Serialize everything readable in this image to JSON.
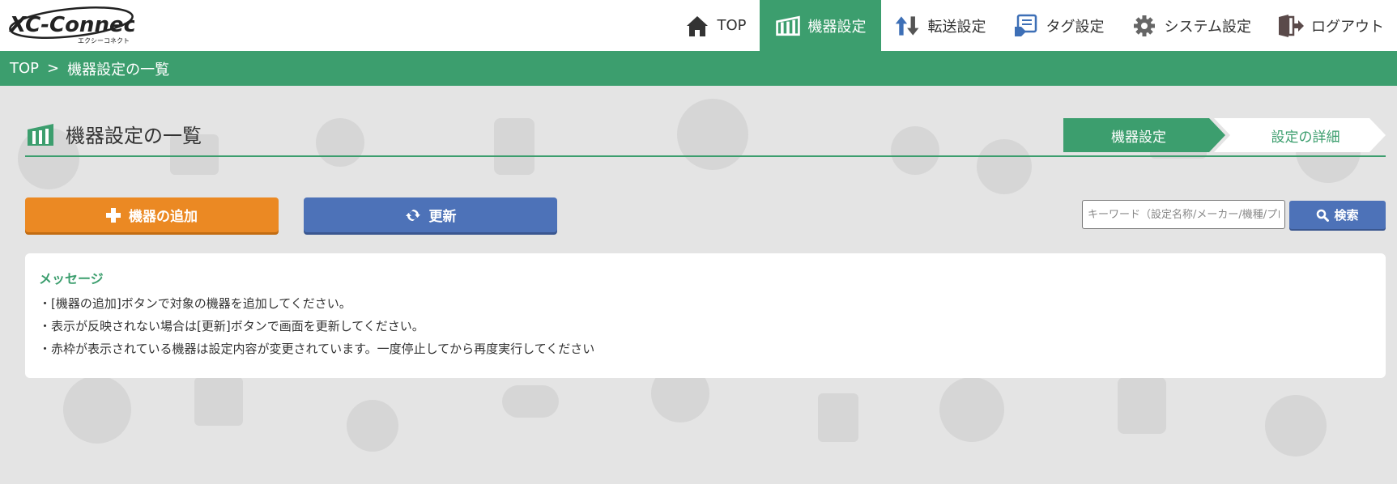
{
  "logo": {
    "text": "XC-Connect",
    "sub": "エクシーコネクト"
  },
  "nav": {
    "items": [
      {
        "label": "TOP",
        "icon": "home-icon"
      },
      {
        "label": "機器設定",
        "icon": "devices-icon",
        "active": true
      },
      {
        "label": "転送設定",
        "icon": "transfer-arrows-icon"
      },
      {
        "label": "タグ設定",
        "icon": "tag-icon"
      },
      {
        "label": "システム設定",
        "icon": "gear-icon"
      },
      {
        "label": "ログアウト",
        "icon": "logout-icon"
      }
    ]
  },
  "breadcrumb": {
    "root": "TOP",
    "separator": ">",
    "current": "機器設定の一覧"
  },
  "page": {
    "title": "機器設定の一覧"
  },
  "steps": [
    {
      "label": "機器設定",
      "active": true
    },
    {
      "label": "設定の詳細",
      "active": false
    }
  ],
  "toolbar": {
    "add_label": "機器の追加",
    "refresh_label": "更新",
    "search_placeholder": "キーワード（設定名称/メーカー/機種/プロトコル）",
    "search_label": "検索"
  },
  "message": {
    "title": "メッセージ",
    "lines": [
      "・[機器の追加]ボタンで対象の機器を追加してください。",
      "・表示が反映されない場合は[更新]ボタンで画面を更新してください。",
      "・赤枠が表示されている機器は設定内容が変更されています。一度停止してから再度実行してください"
    ]
  },
  "colors": {
    "accent": "#3c9e6e",
    "add": "#eb8923",
    "refresh": "#4d72b8",
    "bg": "#e4e4e4"
  }
}
